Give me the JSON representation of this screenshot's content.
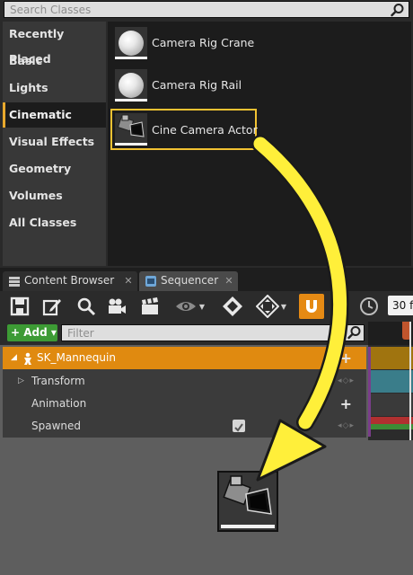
{
  "place_actors": {
    "search": {
      "placeholder": "Search Classes",
      "value": ""
    },
    "categories": [
      {
        "label": "Recently Placed",
        "active": false
      },
      {
        "label": "Basic",
        "active": false
      },
      {
        "label": "Lights",
        "active": false
      },
      {
        "label": "Cinematic",
        "active": true
      },
      {
        "label": "Visual Effects",
        "active": false
      },
      {
        "label": "Geometry",
        "active": false
      },
      {
        "label": "Volumes",
        "active": false
      },
      {
        "label": "All Classes",
        "active": false
      }
    ],
    "classes": [
      {
        "label": "Camera Rig Crane",
        "icon": "sphere-icon",
        "selected": false
      },
      {
        "label": "Camera Rig Rail",
        "icon": "sphere-icon",
        "selected": false
      },
      {
        "label": "Cine Camera Actor",
        "icon": "cine-camera-icon",
        "selected": true
      }
    ]
  },
  "tabs": [
    {
      "label": "Content Browser",
      "icon": "folder-icon",
      "active": false
    },
    {
      "label": "Sequencer",
      "icon": "film-icon",
      "active": true
    }
  ],
  "toolbar": {
    "fps_value": "30 f",
    "buttons": [
      "save-icon",
      "edit-icon",
      "search-icon",
      "camera-icon",
      "clapperboard-icon",
      "eye-icon",
      "key-icon",
      "keyframe-icon",
      "magnet-icon",
      "clock-icon"
    ]
  },
  "sequencer": {
    "add_label": "+ Add ▾",
    "filter": {
      "placeholder": "Filter",
      "value": ""
    },
    "tracks": [
      {
        "label": "SK_Mannequin",
        "type": "actor"
      },
      {
        "label": "Transform",
        "type": "property"
      },
      {
        "label": "Animation",
        "type": "property"
      },
      {
        "label": "Spawned",
        "type": "property",
        "checked": true
      }
    ]
  },
  "colors": {
    "accent_orange": "#e08a10",
    "selection_yellow": "#f1c232",
    "add_green": "#3d9b35",
    "arrow_yellow": "#ffef3a"
  }
}
